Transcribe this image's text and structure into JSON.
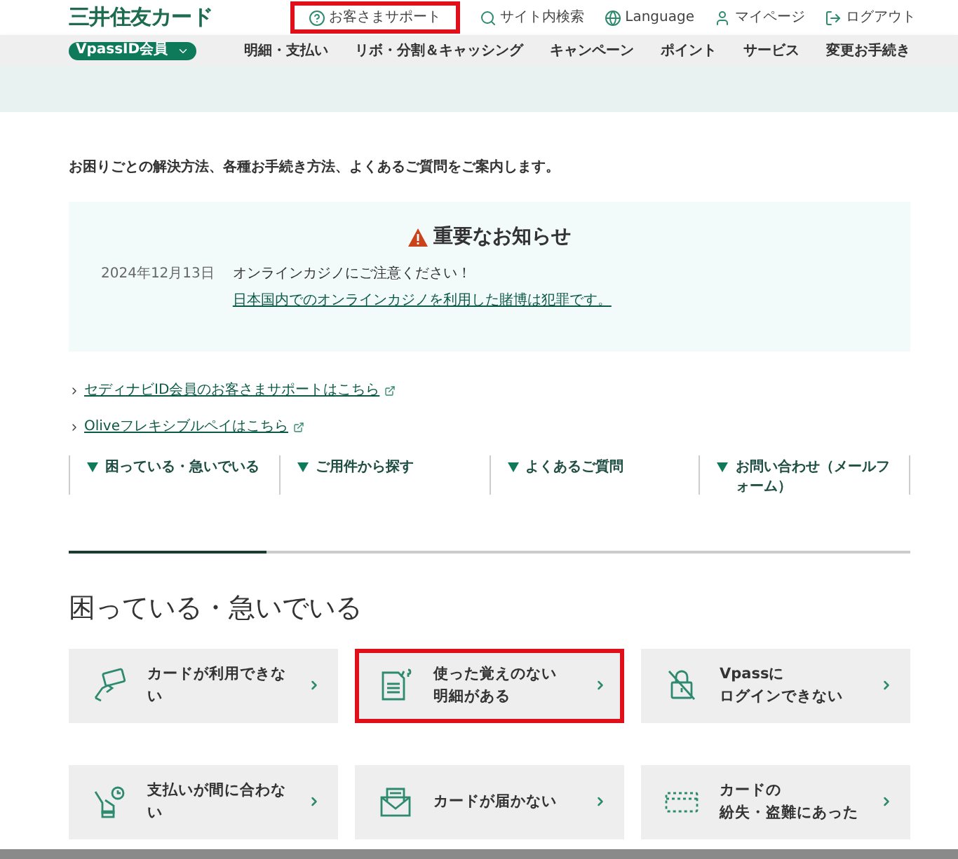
{
  "brand": {
    "logo": "三井住友カード"
  },
  "utility_links": [
    {
      "label": "お客さまサポート",
      "highlighted": true
    },
    {
      "label": "サイト内検索",
      "highlighted": false
    },
    {
      "label": "Language",
      "highlighted": false
    },
    {
      "label": "マイページ",
      "highlighted": false
    },
    {
      "label": "ログアウト",
      "highlighted": false
    }
  ],
  "member_select": {
    "value": "VpassID会員"
  },
  "main_nav": [
    "明細・支払い",
    "リボ・分割＆キャッシング",
    "キャンペーン",
    "ポイント",
    "サービス",
    "変更お手続き"
  ],
  "intro": "お困りごとの解決方法、各種お手続き方法、よくあるご質問をご案内します。",
  "notice": {
    "title": "重要なお知らせ",
    "date": "2024年12月13日",
    "headline": "オンラインカジノにご注意ください！",
    "link": "日本国内でのオンラインカジノを利用した賭博は犯罪です。"
  },
  "external_links": [
    "セディナビID会員のお客さまサポートはこちら",
    "Oliveフレキシブルペイはこちら"
  ],
  "anchor_nav": [
    "困っている・急いでいる",
    "ご用件から探す",
    "よくあるご質問",
    "お問い合わせ（メールフォーム）"
  ],
  "section": {
    "title": "困っている・急いでいる"
  },
  "cards": [
    {
      "lines": [
        "カードが利用できな",
        "い"
      ],
      "highlighted": false
    },
    {
      "lines": [
        "使った覚えのない",
        "明細がある"
      ],
      "highlighted": true
    },
    {
      "lines": [
        "Vpassに",
        "ログインできない"
      ],
      "highlighted": false
    },
    {
      "lines": [
        "支払いが間に合わな",
        "い"
      ],
      "highlighted": false
    },
    {
      "lines": [
        "カードが届かない"
      ],
      "highlighted": false
    },
    {
      "lines": [
        "カードの",
        "紛失・盗難にあった"
      ],
      "highlighted": false
    }
  ]
}
